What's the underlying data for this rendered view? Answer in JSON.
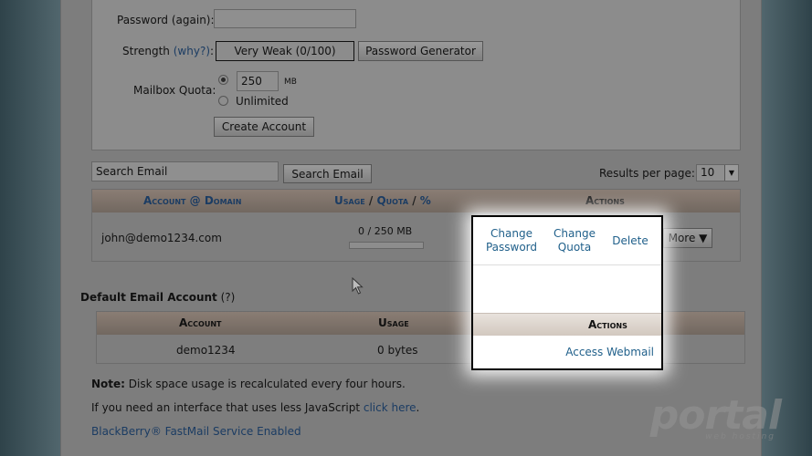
{
  "form": {
    "password_again_label": "Password (again):",
    "strength_label": "Strength",
    "strength_why": "(why?)",
    "strength_colon": ":",
    "strength_value": "Very Weak (0/100)",
    "generator_button": "Password Generator",
    "quota_label": "Mailbox Quota:",
    "quota_value": "250",
    "quota_unit": "MB",
    "unlimited_label": "Unlimited",
    "create_button": "Create Account"
  },
  "search": {
    "placeholder": "Search Email",
    "button": "Search Email",
    "results_label": "Results per page:",
    "results_value": "10"
  },
  "accounts_table": {
    "col_account": "Account @ Domain",
    "col_usage": "Usage",
    "col_quota": "Quota",
    "col_percent": "%",
    "col_actions": "Actions",
    "rows": [
      {
        "email": "john@demo1234.com",
        "usage": "0 / 250 MB",
        "usage_fraction": 0,
        "more": "More ▼"
      }
    ]
  },
  "popup": {
    "change_password": [
      "Change",
      "Password"
    ],
    "change_quota": [
      "Change",
      "Quota"
    ],
    "delete": "Delete",
    "actions_header": "Actions",
    "access_webmail": "Access Webmail"
  },
  "default_account": {
    "title": "Default Email Account",
    "help": "(?)",
    "col_account": "Account",
    "col_usage": "Usage",
    "account": "demo1234",
    "usage": "0 bytes"
  },
  "notes": {
    "note_bold": "Note:",
    "note_text": " Disk space usage is recalculated every four hours.",
    "js_text": "If you need an interface that uses less JavaScript ",
    "js_link": "click here",
    "js_end": ".",
    "blackberry": "BlackBerry® FastMail Service Enabled"
  },
  "watermark": {
    "main": "portal",
    "sub": "web hosting"
  }
}
